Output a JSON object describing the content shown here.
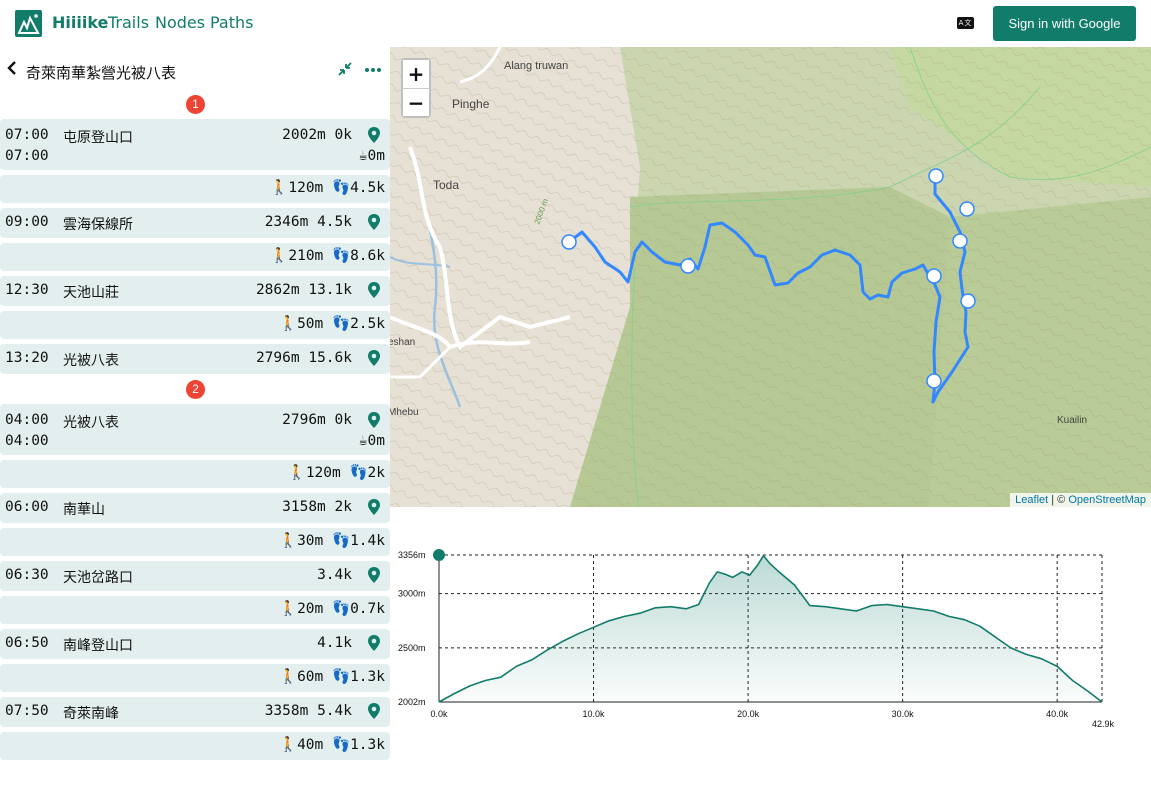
{
  "header": {
    "brand": "Hiiiike",
    "nav": [
      "Trails",
      "Nodes",
      "Paths"
    ],
    "lang_icon": "translate-icon",
    "signin_label": "Sign in with Google",
    "accent": "#127c6a"
  },
  "trip": {
    "title": "奇萊南華紮營光被八表",
    "icons": [
      "chevron-left-icon",
      "collapse-icon",
      "more-icon"
    ]
  },
  "days": [
    {
      "badge": "1",
      "entries": [
        {
          "kind": "node",
          "time": "07:00",
          "time2": "07:00",
          "name": "屯原登山口",
          "elev": "2002m",
          "dist": "0k",
          "rest": "0m"
        },
        {
          "kind": "seg",
          "climb": "120m",
          "walk": "4.5k"
        },
        {
          "kind": "node",
          "time": "09:00",
          "name": "雲海保線所",
          "elev": "2346m",
          "dist": "4.5k"
        },
        {
          "kind": "seg",
          "climb": "210m",
          "walk": "8.6k"
        },
        {
          "kind": "node",
          "time": "12:30",
          "name": "天池山莊",
          "elev": "2862m",
          "dist": "13.1k"
        },
        {
          "kind": "seg",
          "climb": "50m",
          "walk": "2.5k"
        },
        {
          "kind": "node",
          "time": "13:20",
          "name": "光被八表",
          "elev": "2796m",
          "dist": "15.6k"
        }
      ]
    },
    {
      "badge": "2",
      "entries": [
        {
          "kind": "node",
          "time": "04:00",
          "time2": "04:00",
          "name": "光被八表",
          "elev": "2796m",
          "dist": "0k",
          "rest": "0m"
        },
        {
          "kind": "seg",
          "climb": "120m",
          "walk": "2k"
        },
        {
          "kind": "node",
          "time": "06:00",
          "name": "南華山",
          "elev": "3158m",
          "dist": "2k"
        },
        {
          "kind": "seg",
          "climb": "30m",
          "walk": "1.4k"
        },
        {
          "kind": "node",
          "time": "06:30",
          "name": "天池岔路口",
          "elev": "",
          "dist": "3.4k"
        },
        {
          "kind": "seg",
          "climb": "20m",
          "walk": "0.7k"
        },
        {
          "kind": "node",
          "time": "06:50",
          "name": "南峰登山口",
          "elev": "",
          "dist": "4.1k"
        },
        {
          "kind": "seg",
          "climb": "60m",
          "walk": "1.3k"
        },
        {
          "kind": "node",
          "time": "07:50",
          "name": "奇萊南峰",
          "elev": "3358m",
          "dist": "5.4k"
        },
        {
          "kind": "seg",
          "climb": "40m",
          "walk": "1.3k"
        }
      ]
    }
  ],
  "map": {
    "labels": [
      "Alang truwan",
      "Pinghe",
      "Toda",
      "2000 m",
      "eshan",
      "Mhebu",
      "Kuailin"
    ],
    "attribution_leaflet": "Leaflet",
    "attribution_sep": " | © ",
    "attribution_osm": "OpenStreetMap",
    "route_color": "#3388ff"
  },
  "elevation": {
    "y_labels": [
      "3356m",
      "3000m",
      "2500m",
      "2002m"
    ],
    "x_labels": [
      "0.0k",
      "10.0k",
      "20.0k",
      "30.0k",
      "40.0k"
    ],
    "x_end": "42.9k",
    "ylim": [
      2002,
      3356
    ],
    "xlim": [
      0,
      42.9
    ],
    "profile": [
      [
        0,
        2002
      ],
      [
        1,
        2080
      ],
      [
        2,
        2150
      ],
      [
        3,
        2200
      ],
      [
        4,
        2230
      ],
      [
        5,
        2330
      ],
      [
        6,
        2390
      ],
      [
        7,
        2480
      ],
      [
        8,
        2560
      ],
      [
        9,
        2630
      ],
      [
        10,
        2690
      ],
      [
        11,
        2750
      ],
      [
        12,
        2790
      ],
      [
        13,
        2820
      ],
      [
        14,
        2870
      ],
      [
        15,
        2880
      ],
      [
        16,
        2860
      ],
      [
        16.8,
        2900
      ],
      [
        17.5,
        3100
      ],
      [
        18,
        3200
      ],
      [
        18.5,
        3180
      ],
      [
        19,
        3150
      ],
      [
        19.6,
        3200
      ],
      [
        20.1,
        3170
      ],
      [
        20.6,
        3260
      ],
      [
        21,
        3350
      ],
      [
        21.4,
        3280
      ],
      [
        22,
        3200
      ],
      [
        23,
        3080
      ],
      [
        24,
        2890
      ],
      [
        25,
        2880
      ],
      [
        26,
        2860
      ],
      [
        27,
        2840
      ],
      [
        28,
        2890
      ],
      [
        29,
        2900
      ],
      [
        30,
        2880
      ],
      [
        31,
        2860
      ],
      [
        32,
        2840
      ],
      [
        33,
        2790
      ],
      [
        34,
        2760
      ],
      [
        35,
        2700
      ],
      [
        36,
        2600
      ],
      [
        37,
        2500
      ],
      [
        38,
        2440
      ],
      [
        39,
        2400
      ],
      [
        40,
        2330
      ],
      [
        41,
        2200
      ],
      [
        42,
        2100
      ],
      [
        42.9,
        2002
      ]
    ],
    "line_color": "#127c6a"
  }
}
